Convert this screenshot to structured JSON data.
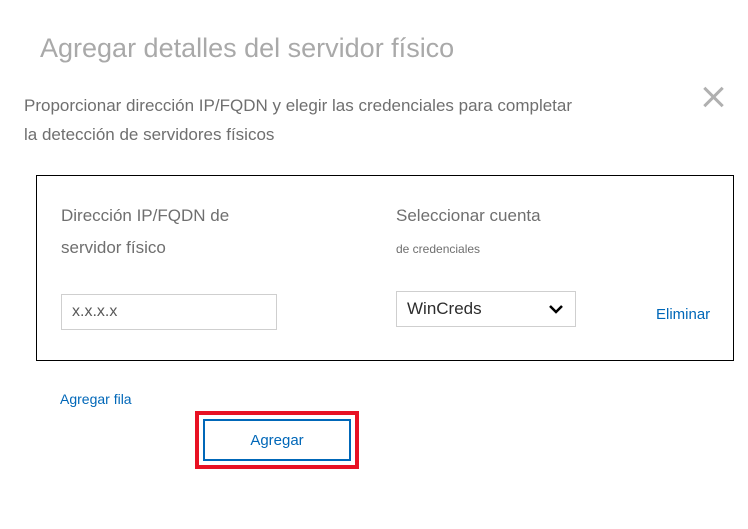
{
  "dialog": {
    "title": "Agregar detalles del servidor físico",
    "description_line1": "Proporcionar dirección IP/FQDN y elegir las credenciales para completar",
    "description_line2": "la detección de servidores físicos"
  },
  "form": {
    "ip_label_line1": "Dirección IP/FQDN de",
    "ip_label_line2": "servidor físico",
    "ip_value": "x.x.x.x",
    "creds_label_main": "Seleccionar cuenta",
    "creds_label_sub": "de credenciales",
    "creds_selected": "WinCreds",
    "eliminate_link": "Eliminar",
    "add_row_link": "Agregar fila",
    "add_button": "Agregar"
  }
}
